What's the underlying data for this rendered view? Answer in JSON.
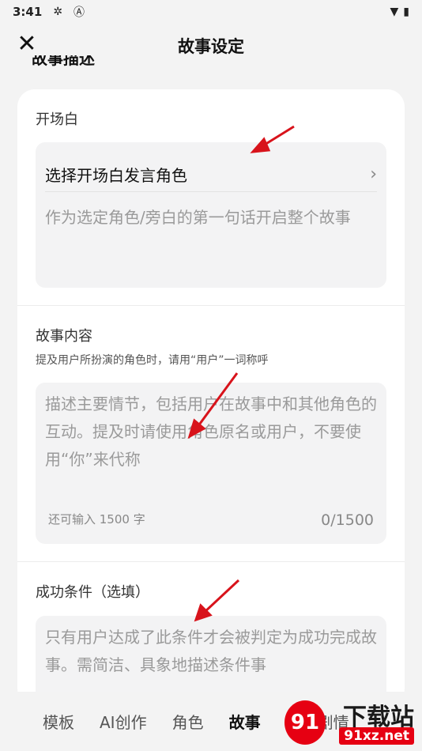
{
  "status_bar": {
    "time": "3:41"
  },
  "header": {
    "title": "故事设定"
  },
  "partial_heading": "故事描述",
  "opening": {
    "label": "开场白",
    "select_label": "选择开场白发言角色",
    "placeholder": "作为选定角色/旁白的第一句话开启整个故事"
  },
  "story": {
    "label": "故事内容",
    "hint": "提及用户所扮演的角色时，请用“用户”一词称呼",
    "placeholder": "描述主要情节，包括用户在故事中和其他角色的互动。提及时请使用角色原名或用户，不要使用“你”来代称",
    "remaining": "还可输入 1500 字",
    "counter": "0/1500"
  },
  "success": {
    "label": "成功条件（选填）",
    "placeholder": "只有用户达成了此条件才会被判定为成功完成故事。需简洁、具象地描述条件事"
  },
  "tabs": [
    {
      "label": "模板"
    },
    {
      "label": "AI创作"
    },
    {
      "label": "角色"
    },
    {
      "label": "故事"
    },
    {
      "label": "对话剧情"
    }
  ],
  "watermark": {
    "top": "下载站",
    "bottom": "91xz.net",
    "logo": "91"
  },
  "colors": {
    "arrow": "#d8131b",
    "watermark": "#e60012"
  }
}
